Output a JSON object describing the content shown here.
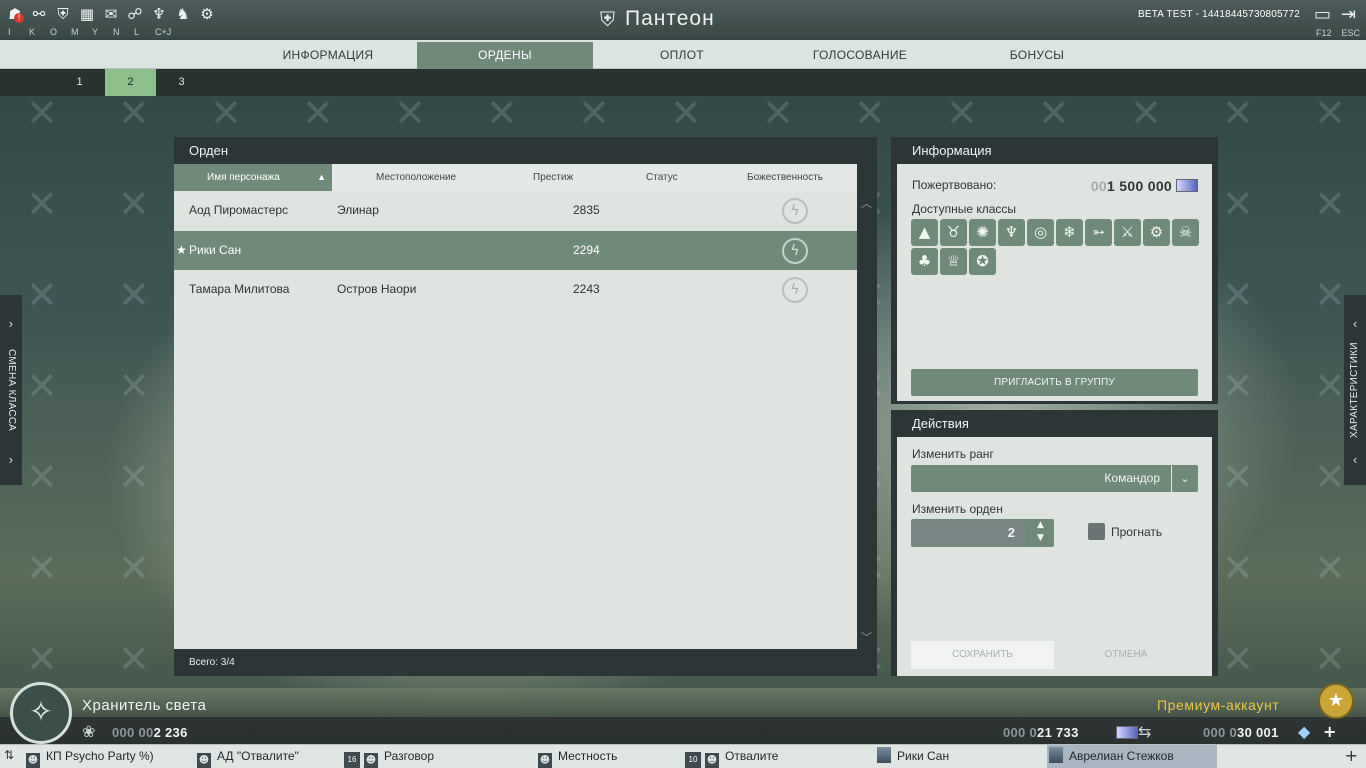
{
  "topbar": {
    "hotkeys": [
      "I",
      "K",
      "O",
      "M",
      "Y",
      "N",
      "L",
      "C+J"
    ],
    "icons": [
      "profile-icon",
      "network-icon",
      "pantheon-icon",
      "map-icon",
      "chat-icon",
      "handshake-icon",
      "mask-icon",
      "horse-icon",
      "gear-icon"
    ],
    "title": "Пантеон",
    "beta": "BETA TEST - 1441844573080577​2",
    "right_keys": [
      "F12",
      "ESC"
    ]
  },
  "tabs": [
    "Информация",
    "Ордены",
    "Оплот",
    "Голосование",
    "Бонусы"
  ],
  "active_tab": 1,
  "subtabs": [
    "1",
    "2",
    "3"
  ],
  "active_subtab": 1,
  "order": {
    "title": "Орден",
    "columns": [
      "Имя персонажа",
      "Местоположение",
      "Престиж",
      "Статус",
      "Божественность"
    ],
    "rows": [
      {
        "name": "Аод Пиромастерс",
        "location": "Элинар",
        "prestige": "2835",
        "status": ""
      },
      {
        "name": "Рики Сан",
        "location": "",
        "prestige": "2294",
        "status": ""
      },
      {
        "name": "Тамара Милитова",
        "location": "Остров Наори",
        "prestige": "2243",
        "status": ""
      }
    ],
    "selected_row": 1,
    "total": "Всего: 3/4"
  },
  "info": {
    "title": "Информация",
    "donated_label": "Пожертвовано:",
    "donated_dim": "00",
    "donated_value": "1 500 000",
    "classes_label": "Доступные классы",
    "invite_label": "Пригласить в группу"
  },
  "actions": {
    "title": "Действия",
    "rank_label": "Изменить ранг",
    "rank_value": "Командор",
    "order_label": "Изменить орден",
    "order_value": "2",
    "kick_label": "Прогнать",
    "save_label": "Сохранить",
    "cancel_label": "Отмена"
  },
  "side": {
    "left": "Смена класса",
    "right": "Характеристики"
  },
  "status": {
    "title": "Хранитель света",
    "premium": "Премиум-аккаунт",
    "currency1_dim": "000 00",
    "currency1": "2 236",
    "currency2_dim": "000 0",
    "currency2": "21 733",
    "currency3_dim": "000 0",
    "currency3": "30 001"
  },
  "chats": [
    {
      "label": "КП Psycho Party %)",
      "count": ""
    },
    {
      "label": "АД \"Отвалите\"",
      "count": ""
    },
    {
      "label": "Разговор",
      "count": "16"
    },
    {
      "label": "Местность",
      "count": ""
    },
    {
      "label": "Отвалите",
      "count": "10"
    },
    {
      "label": "Рики Сан",
      "count": ""
    },
    {
      "label": "Аврелиан Стежков",
      "count": ""
    }
  ],
  "active_chat": 6,
  "colors": {
    "accent": "#6f8a78",
    "subtab_active": "#8cbf8c",
    "premium": "#e8c648"
  }
}
